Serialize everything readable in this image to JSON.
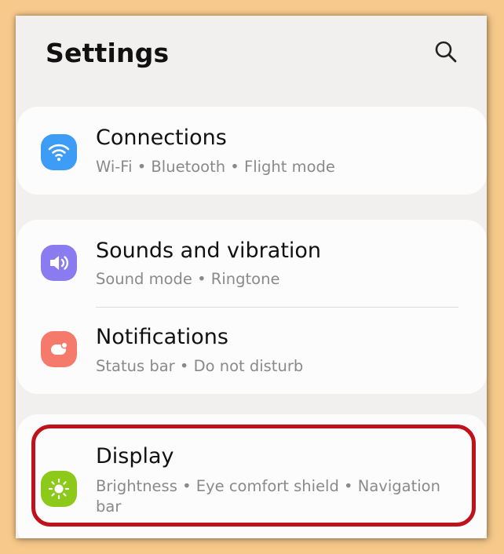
{
  "header": {
    "title": "Settings",
    "search_icon": "search-icon"
  },
  "groups": [
    {
      "items": [
        {
          "id": "connections",
          "title": "Connections",
          "subtitle": "Wi-Fi  •  Bluetooth  •  Flight mode",
          "icon": "wifi-icon",
          "icon_color": "#3d9cf5"
        }
      ]
    },
    {
      "items": [
        {
          "id": "sounds",
          "title": "Sounds and vibration",
          "subtitle": "Sound mode  •  Ringtone",
          "icon": "volume-icon",
          "icon_color": "#8a7bf0"
        },
        {
          "id": "notifications",
          "title": "Notifications",
          "subtitle": "Status bar  •  Do not disturb",
          "icon": "notification-icon",
          "icon_color": "#f57a6b"
        }
      ]
    },
    {
      "items": [
        {
          "id": "display",
          "title": "Display",
          "subtitle": "Brightness  •  Eye comfort shield  •  Navigation bar",
          "icon": "brightness-icon",
          "icon_color": "#8cc91a"
        }
      ]
    }
  ],
  "highlight_color": "#c0121b"
}
